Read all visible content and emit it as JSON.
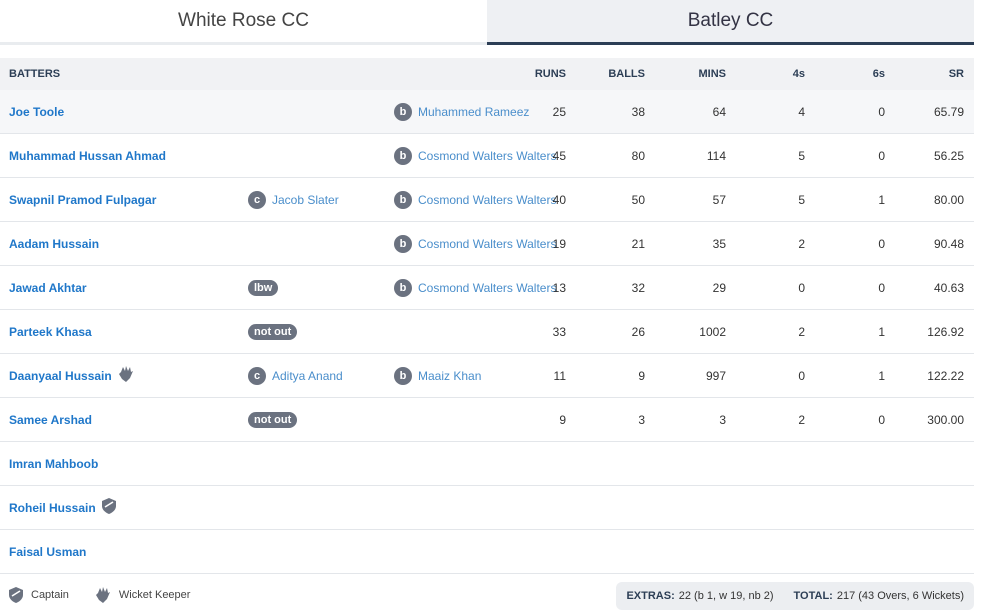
{
  "tabs": [
    {
      "label": "White Rose CC",
      "active": false
    },
    {
      "label": "Batley CC",
      "active": true
    }
  ],
  "table": {
    "headers": {
      "batters": "BATTERS",
      "runs": "RUNS",
      "balls": "BALLS",
      "mins": "MINS",
      "fours": "4s",
      "sixes": "6s",
      "sr": "SR"
    },
    "rows": [
      {
        "name": "Joe Toole",
        "fielder_type": "",
        "fielder": "",
        "bowler_type": "b",
        "bowler": "Muhammed Rameez",
        "runs": "25",
        "balls": "38",
        "mins": "64",
        "fours": "4",
        "sixes": "0",
        "sr": "65.79"
      },
      {
        "name": "Muhammad Hussan Ahmad",
        "fielder_type": "",
        "fielder": "",
        "bowler_type": "b",
        "bowler": "Cosmond Walters Walters",
        "runs": "45",
        "balls": "80",
        "mins": "114",
        "fours": "5",
        "sixes": "0",
        "sr": "56.25"
      },
      {
        "name": "Swapnil Pramod Fulpagar",
        "fielder_type": "c",
        "fielder": "Jacob Slater",
        "bowler_type": "b",
        "bowler": "Cosmond Walters Walters",
        "runs": "40",
        "balls": "50",
        "mins": "57",
        "fours": "5",
        "sixes": "1",
        "sr": "80.00"
      },
      {
        "name": "Aadam Hussain",
        "fielder_type": "",
        "fielder": "",
        "bowler_type": "b",
        "bowler": "Cosmond Walters Walters",
        "runs": "19",
        "balls": "21",
        "mins": "35",
        "fours": "2",
        "sixes": "0",
        "sr": "90.48"
      },
      {
        "name": "Jawad Akhtar",
        "fielder_type": "lbw",
        "fielder": "",
        "bowler_type": "b",
        "bowler": "Cosmond Walters Walters",
        "runs": "13",
        "balls": "32",
        "mins": "29",
        "fours": "0",
        "sixes": "0",
        "sr": "40.63"
      },
      {
        "name": "Parteek Khasa",
        "fielder_type": "not out",
        "fielder": "",
        "bowler_type": "",
        "bowler": "",
        "runs": "33",
        "balls": "26",
        "mins": "1002",
        "fours": "2",
        "sixes": "1",
        "sr": "126.92"
      },
      {
        "name": "Daanyaal Hussain",
        "role_icon": "wicket-keeper-icon",
        "fielder_type": "c",
        "fielder": "Aditya Anand",
        "bowler_type": "b",
        "bowler": "Maaiz Khan",
        "runs": "11",
        "balls": "9",
        "mins": "997",
        "fours": "0",
        "sixes": "1",
        "sr": "122.22"
      },
      {
        "name": "Samee Arshad",
        "fielder_type": "not out",
        "fielder": "",
        "bowler_type": "",
        "bowler": "",
        "runs": "9",
        "balls": "3",
        "mins": "3",
        "fours": "2",
        "sixes": "0",
        "sr": "300.00"
      },
      {
        "name": "Imran Mahboob"
      },
      {
        "name": "Roheil Hussain",
        "role_icon": "captain-icon"
      },
      {
        "name": "Faisal Usman"
      }
    ]
  },
  "legend": {
    "captain": "Captain",
    "wicket_keeper": "Wicket Keeper"
  },
  "totals": {
    "extras_label": "EXTRAS:",
    "extras_value": "22 (b 1, w 19, nb 2)",
    "total_label": "TOTAL:",
    "total_value": "217 (43 Overs, 6 Wickets)"
  },
  "colors": {
    "accent": "#2c3e55",
    "link": "#1f77c9",
    "badge": "#6b7280"
  }
}
